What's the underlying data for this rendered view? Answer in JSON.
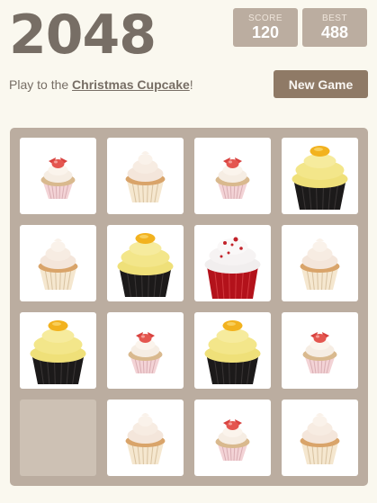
{
  "game": {
    "title": "2048",
    "score_label": "SCORE",
    "score": "120",
    "best_label": "BEST",
    "best": "488",
    "intro_prefix": "Play to the ",
    "intro_link": "Christmas Cupcake",
    "intro_suffix": "!",
    "new_game_label": "New Game"
  },
  "board": {
    "rows": 4,
    "cols": 4,
    "tiles": [
      [
        "cupcake-small-pink",
        "cupcake-small-cream",
        "cupcake-small-pink",
        "cupcake-yellow-black"
      ],
      [
        "cupcake-small-cream",
        "cupcake-yellow-black",
        "cupcake-red-velvet",
        "cupcake-small-cream"
      ],
      [
        "cupcake-yellow-black",
        "cupcake-small-pink",
        "cupcake-yellow-black",
        "cupcake-small-pink"
      ],
      [
        "empty",
        "cupcake-small-cream",
        "cupcake-small-pink",
        "cupcake-small-cream"
      ]
    ]
  },
  "colors": {
    "background": "#faf8ef",
    "board": "#bbada0",
    "empty_cell": "#cdc1b4",
    "button": "#8f7a66",
    "text": "#776e65"
  }
}
